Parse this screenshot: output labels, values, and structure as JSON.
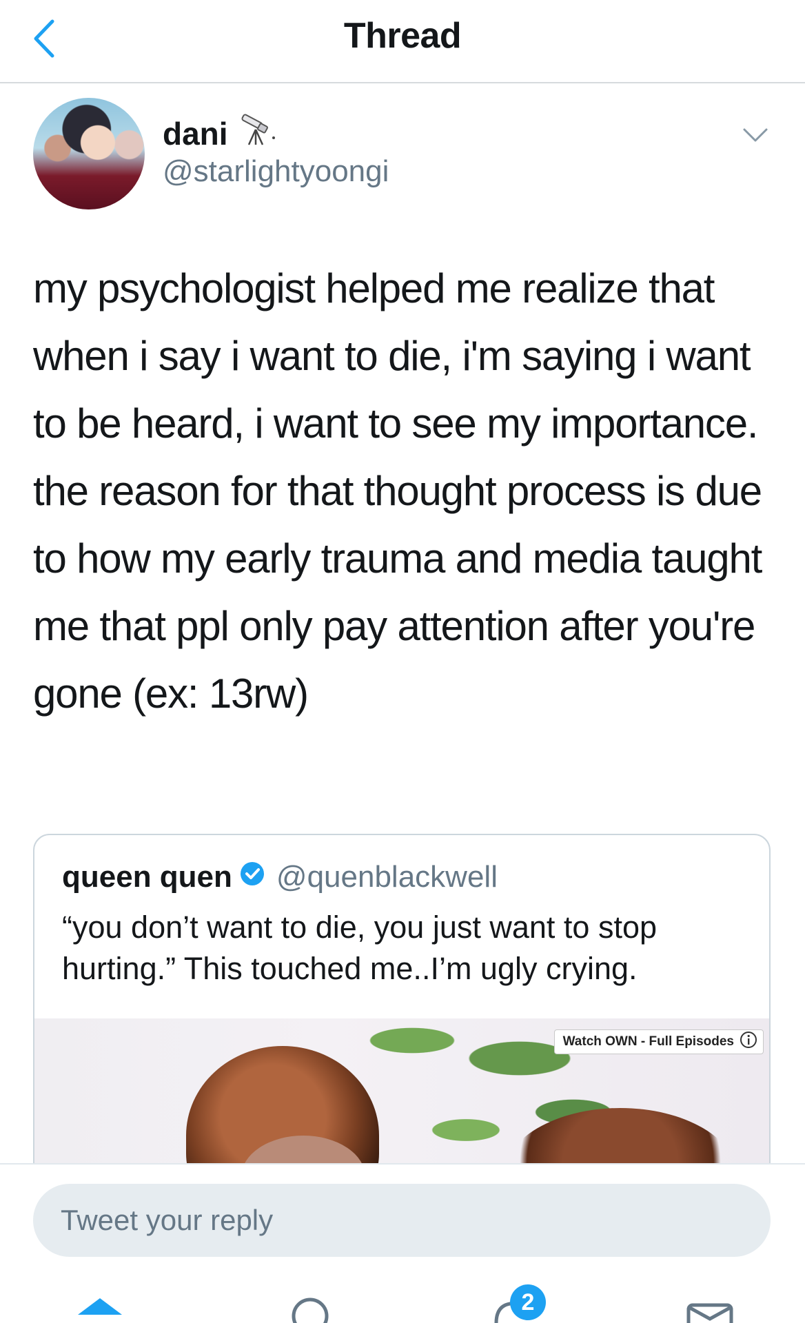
{
  "header": {
    "title": "Thread",
    "back_icon": "chevron-left-icon"
  },
  "tweet": {
    "author_name": "dani",
    "author_name_emoji": "telescope-icon",
    "author_handle": "@starlightyoongi",
    "text": "my psychologist helped me realize that when i say i want to die, i'm saying i want to be heard, i want to see my importance. the reason for that thought process is due to how my early trauma and media taught me that ppl only pay attention after you're gone (ex: 13rw)"
  },
  "quote": {
    "name": "queen quen",
    "handle": "@quenblackwell",
    "verified": true,
    "text": "“you don’t want to die, you just want to stop hurting.” This touched me..I’m ugly crying.",
    "media_badge": "Watch OWN - Full Episodes"
  },
  "reply": {
    "placeholder": "Tweet your reply"
  },
  "tabbar": {
    "tabs": [
      "home-icon",
      "search-icon",
      "notifications-icon",
      "messages-icon"
    ],
    "notifications_count": "2"
  },
  "colors": {
    "accent": "#1da1f2",
    "text_primary": "#14171a",
    "text_secondary": "#657786",
    "border": "#ccd6dd"
  }
}
